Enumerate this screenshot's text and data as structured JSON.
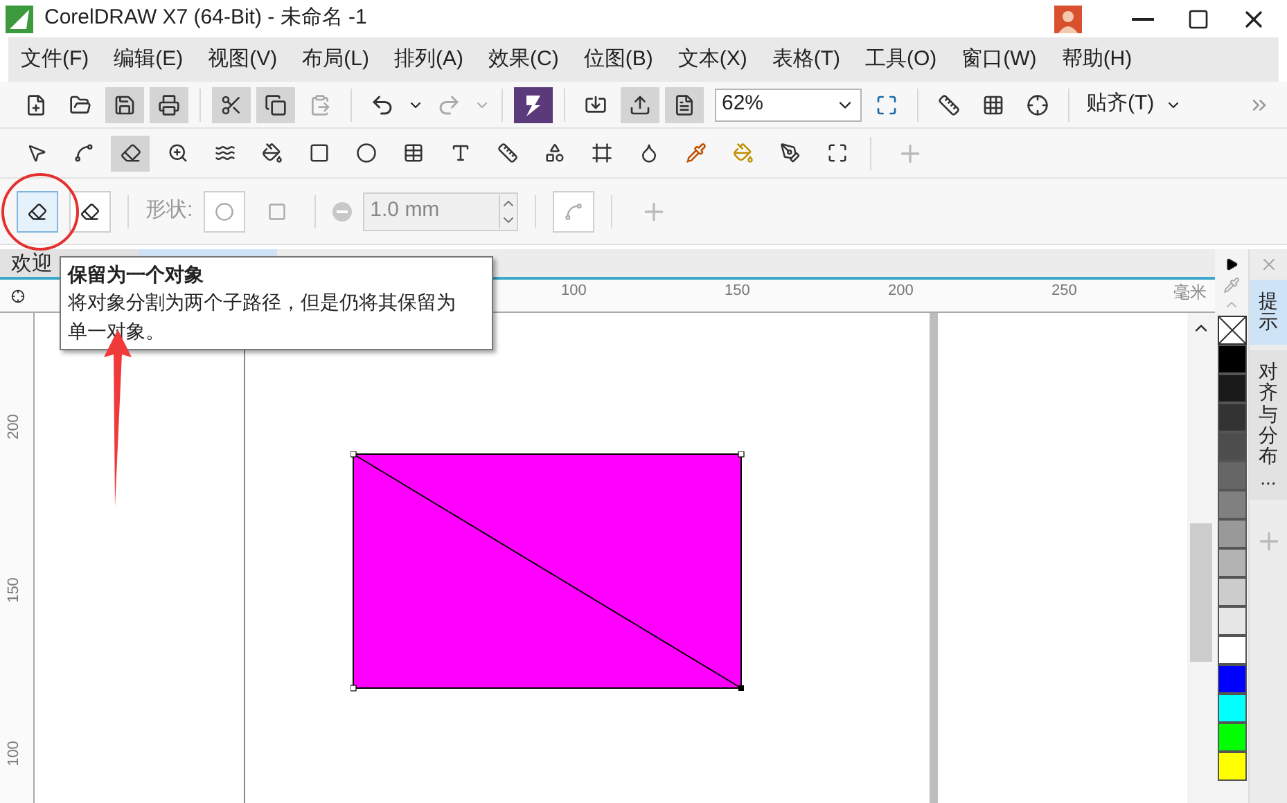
{
  "window": {
    "title": "CorelDRAW X7 (64-Bit) - 未命名 -1"
  },
  "menu": [
    "文件(F)",
    "编辑(E)",
    "视图(V)",
    "布局(L)",
    "排列(A)",
    "效果(C)",
    "位图(B)",
    "文本(X)",
    "表格(T)",
    "工具(O)",
    "窗口(W)",
    "帮助(H)"
  ],
  "standard_toolbar": {
    "zoom": "62%",
    "snap": "贴齐(T)"
  },
  "property_bar": {
    "modes": [
      {
        "selected": true
      },
      {
        "selected": false
      }
    ],
    "shape_label": "形状:",
    "nib_size": "1.0 mm"
  },
  "tabs": [
    {
      "label": "欢迎",
      "selected": false
    },
    {
      "selected": true
    }
  ],
  "tooltip": {
    "title": "保留为一个对象",
    "text": "将对象分割为两个子路径，但是仍将其保留为单一对象。"
  },
  "ruler": {
    "top_labels": [
      "100",
      "150",
      "200",
      "250"
    ],
    "unit": "毫米",
    "left_labels": [
      "200",
      "150",
      "100"
    ]
  },
  "palette": [
    {
      "color": "#000000"
    },
    {
      "color": "#1a1a1a"
    },
    {
      "color": "#333333"
    },
    {
      "color": "#4d4d4d"
    },
    {
      "color": "#666666"
    },
    {
      "color": "#808080"
    },
    {
      "color": "#999999"
    },
    {
      "color": "#b3b3b3"
    },
    {
      "color": "#cccccc"
    },
    {
      "color": "#e6e6e6"
    },
    {
      "color": "#ffffff"
    },
    {
      "color": "#0000ff"
    },
    {
      "color": "#00ffff"
    },
    {
      "color": "#00ff00"
    },
    {
      "color": "#ffff00"
    }
  ],
  "dockers": [
    {
      "label": "提示",
      "selected": true
    },
    {
      "label": "对齐与分布...",
      "selected": false
    }
  ]
}
